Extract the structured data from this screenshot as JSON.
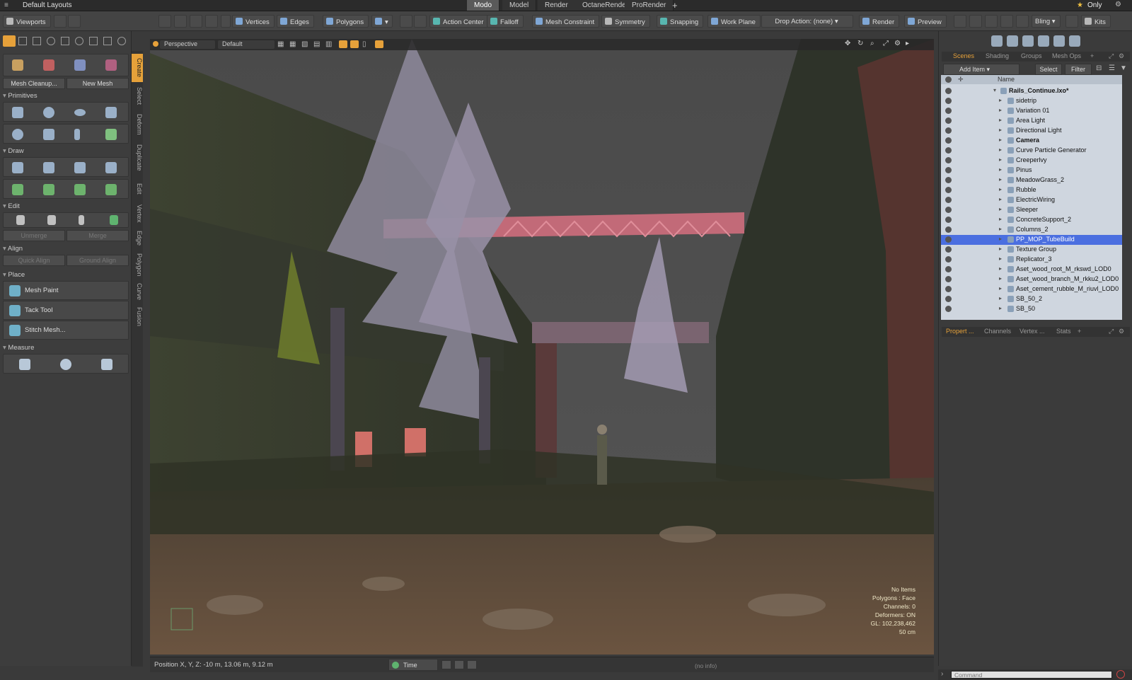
{
  "app": {
    "layout_title": "Default Layouts"
  },
  "mode_tabs": [
    {
      "label": "Modo",
      "active": true
    },
    {
      "label": "Model",
      "active": false
    },
    {
      "label": "Render",
      "active": false
    },
    {
      "label": "OctaneRender",
      "active": false
    },
    {
      "label": "ProRender",
      "active": false
    }
  ],
  "top_right": {
    "only_label": "Only"
  },
  "toolbar": {
    "viewports": "Viewports",
    "vertices": "Vertices",
    "edges": "Edges",
    "polygons": "Polygons",
    "action_center": "Action Center",
    "falloff": "Falloff",
    "mesh_constraint": "Mesh Constraint",
    "symmetry": "Symmetry",
    "snapping": "Snapping",
    "work_plane": "Work Plane",
    "drop_action": "Drop Action: (none)",
    "render": "Render",
    "preview": "Preview",
    "bling": "Bling",
    "kits": "Kits"
  },
  "left_panel": {
    "mesh_cleanup": "Mesh Cleanup...",
    "new_mesh": "New Mesh",
    "sections": {
      "primitives": "Primitives",
      "draw": "Draw",
      "edit": "Edit",
      "align": "Align",
      "place": "Place",
      "measure": "Measure"
    },
    "unmerge": "Unmerge",
    "merge": "Merge",
    "quick_align": "Quick Align",
    "ground_align": "Ground Align",
    "mesh_paint": "Mesh Paint",
    "tack_tool": "Tack Tool",
    "stitch_mesh": "Stitch Mesh..."
  },
  "vertical_tabs": [
    "Create",
    "Select",
    "Deform",
    "Duplicate",
    "Edit",
    "Vertex",
    "Edge",
    "Polygon",
    "Curve",
    "Fusion"
  ],
  "viewport": {
    "view": "Perspective",
    "shading": "Default",
    "info": [
      "No Items",
      "Polygons : Face",
      "Channels: 0",
      "Deformers: ON",
      "GL: 102,238,462",
      "50 cm"
    ]
  },
  "status": {
    "position": "Position X, Y, Z:   -10 m, 13.06 m, 9.12 m",
    "time": "Time",
    "no_info": "(no info)"
  },
  "right_panel": {
    "tabs": [
      "Scenes",
      "Shading",
      "Groups",
      "Mesh Ops"
    ],
    "add_item": "Add Item",
    "select": "Select",
    "filter": "Filter",
    "tree_header": "Name",
    "tree_items": [
      {
        "label": "Rails_Continue.lxo*",
        "bold": true,
        "selected": false
      },
      {
        "label": "sidetrip",
        "bold": false,
        "selected": false
      },
      {
        "label": "Variation 01",
        "bold": false,
        "selected": false
      },
      {
        "label": "Area Light",
        "bold": false,
        "selected": false
      },
      {
        "label": "Directional Light",
        "bold": false,
        "selected": false
      },
      {
        "label": "Camera",
        "bold": true,
        "selected": false
      },
      {
        "label": "Curve Particle Generator",
        "bold": false,
        "selected": false
      },
      {
        "label": "Creeperlvy",
        "bold": false,
        "selected": false
      },
      {
        "label": "Pinus",
        "bold": false,
        "selected": false
      },
      {
        "label": "MeadowGrass_2",
        "bold": false,
        "selected": false
      },
      {
        "label": "Rubble",
        "bold": false,
        "selected": false
      },
      {
        "label": "ElectricWiring",
        "bold": false,
        "selected": false
      },
      {
        "label": "Sleeper",
        "bold": false,
        "selected": false
      },
      {
        "label": "ConcreteSupport_2",
        "bold": false,
        "selected": false
      },
      {
        "label": "Columns_2",
        "bold": false,
        "selected": false
      },
      {
        "label": "PP_MOP_TubeBuild",
        "bold": false,
        "selected": true
      },
      {
        "label": "Texture Group",
        "bold": false,
        "selected": false
      },
      {
        "label": "Replicator_3",
        "bold": false,
        "selected": false
      },
      {
        "label": "Aset_wood_root_M_rkswd_LOD0",
        "bold": false,
        "selected": false
      },
      {
        "label": "Aset_wood_branch_M_rkku2_LOD0",
        "bold": false,
        "selected": false
      },
      {
        "label": "Aset_cement_rubble_M_riuvl_LOD0",
        "bold": false,
        "selected": false
      },
      {
        "label": "SB_50_2",
        "bold": false,
        "selected": false
      },
      {
        "label": "SB_50",
        "bold": false,
        "selected": false
      }
    ],
    "lower_tabs": [
      "Propert ...",
      "Channels",
      "Vertex ...",
      "Stats"
    ],
    "command_placeholder": "Command"
  },
  "colors": {
    "accent": "#e6a13a",
    "selection": "#4b6fe0"
  }
}
